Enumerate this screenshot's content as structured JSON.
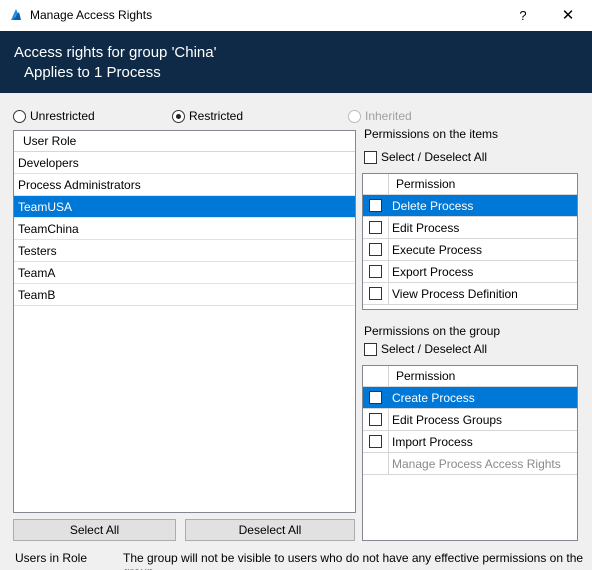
{
  "window": {
    "title": "Manage Access Rights",
    "help_label": "?",
    "close_label": "✕"
  },
  "header": {
    "line1": "Access rights for group 'China'",
    "line2": "Applies to 1 Process",
    "background": "#0e2a47"
  },
  "access_mode": {
    "options": [
      {
        "label": "Unrestricted",
        "checked": false,
        "enabled": true
      },
      {
        "label": "Restricted",
        "checked": true,
        "enabled": true
      },
      {
        "label": "Inherited",
        "checked": false,
        "enabled": false
      }
    ]
  },
  "roles": {
    "column_header": "User Role",
    "rows": [
      "Developers",
      "Process Administrators",
      "TeamUSA",
      "TeamChina",
      "Testers",
      "TeamA",
      "TeamB"
    ],
    "selected": "TeamUSA",
    "select_all_label": "Select All",
    "deselect_all_label": "Deselect All"
  },
  "item_permissions": {
    "section_label": "Permissions on the items",
    "select_toggle_label": "Select / Deselect All",
    "column_header": "Permission",
    "rows": [
      "Delete Process",
      "Edit Process",
      "Execute Process",
      "Export Process",
      "View Process Definition"
    ],
    "selected": "Delete Process"
  },
  "group_permissions": {
    "section_label": "Permissions on the group",
    "select_toggle_label": "Select / Deselect All",
    "column_header": "Permission",
    "rows": [
      "Create Process",
      "Edit Process Groups",
      "Import Process"
    ],
    "disabled_row": "Manage Process Access Rights",
    "selected": "Create Process"
  },
  "footer": {
    "users_in_role": "Users in Role",
    "notice": "The group will not be visible to users who do not have any effective permissions on the group."
  },
  "colors": {
    "accent": "#0078d7",
    "app_icon": "#1e8fe0"
  }
}
